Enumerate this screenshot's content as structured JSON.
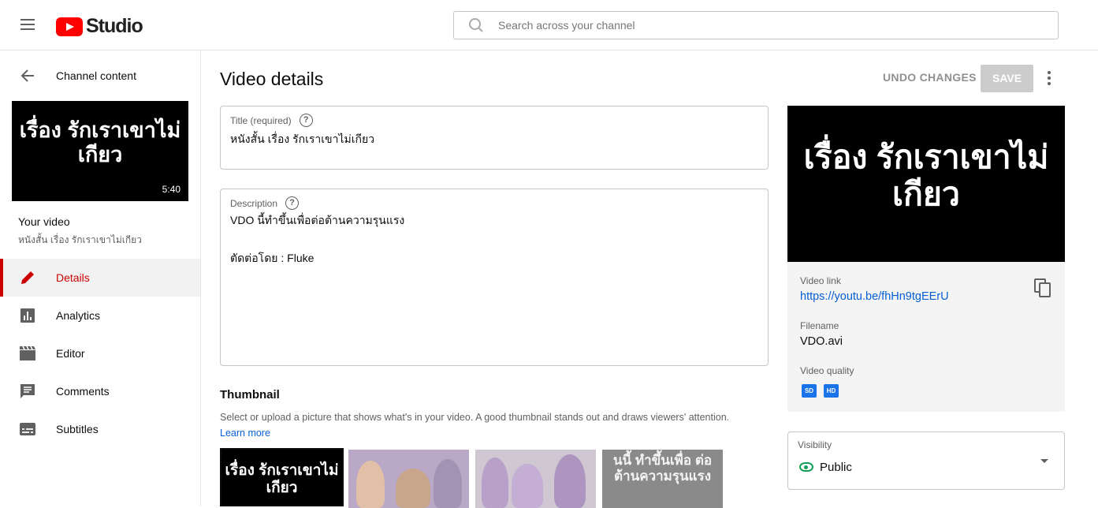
{
  "header": {
    "logo_text": "Studio",
    "search_placeholder": "Search across your channel"
  },
  "sidebar": {
    "back_label": "Channel content",
    "thumbnail_text": "เรื่อง รักเราเขาไม่เกียว",
    "duration": "5:40",
    "your_video_label": "Your video",
    "video_title": "หนังสั้น เรื่อง รักเราเขาไม่เกียว",
    "items": [
      {
        "label": "Details",
        "icon": "pencil-icon",
        "active": true
      },
      {
        "label": "Analytics",
        "icon": "analytics-icon",
        "active": false
      },
      {
        "label": "Editor",
        "icon": "clapperboard-icon",
        "active": false
      },
      {
        "label": "Comments",
        "icon": "comment-icon",
        "active": false
      },
      {
        "label": "Subtitles",
        "icon": "subtitles-icon",
        "active": false
      }
    ]
  },
  "main": {
    "page_title": "Video details",
    "undo_label": "UNDO CHANGES",
    "save_label": "SAVE",
    "title_field": {
      "label": "Title (required)",
      "value": "หนังสั้น เรื่อง รักเราเขาไม่เกียว"
    },
    "description_field": {
      "label": "Description",
      "lines": [
        "VDO นี้ทำขึ้นเพื่อต่อต้านความรุนแรง",
        "",
        "ตัดต่อโดย : Fluke"
      ]
    },
    "thumbnail": {
      "heading": "Thumbnail",
      "description": "Select or upload a picture that shows what's in your video. A good thumbnail stands out and draws viewers' attention.",
      "learn_more": "Learn more",
      "option1_text": "เรื่อง รักเราเขาไม่เกียว",
      "option4_text": "นนี้ ทำขึ้นเพื่อ ต่อต้านความรุนแรง"
    }
  },
  "right_panel": {
    "preview_text": "เรื่อง รักเราเขาไม่เกียว",
    "video_link_label": "Video link",
    "video_link": "https://youtu.be/fhHn9tgEErU",
    "filename_label": "Filename",
    "filename": "VDO.avi",
    "quality_label": "Video quality",
    "quality_badges": [
      "SD",
      "HD"
    ],
    "visibility_label": "Visibility",
    "visibility_value": "Public"
  },
  "colors": {
    "accent_red": "#cc0000",
    "link_blue": "#065fd4",
    "public_green": "#0f9d58"
  }
}
